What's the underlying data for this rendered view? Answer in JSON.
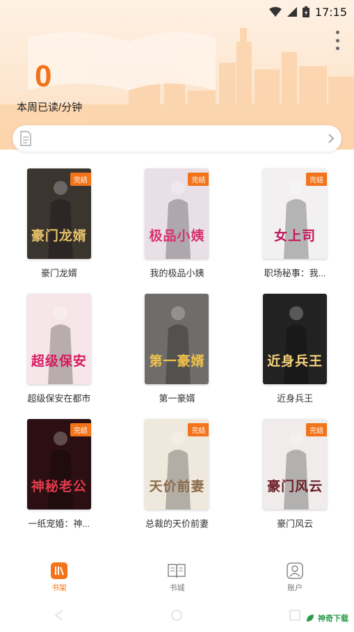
{
  "status_bar": {
    "time": "17:15"
  },
  "header": {
    "read_minutes": "0",
    "read_label": "本周已读/分钟"
  },
  "search": {
    "placeholder": ""
  },
  "badge_label": "完结",
  "books": [
    {
      "name": "豪门龙婿",
      "cover_title": "豪门龙婿",
      "badge": true,
      "bg": "#3b3530",
      "fg": "#e7c36a"
    },
    {
      "name": "我的极品小姨",
      "cover_title": "极品小姨",
      "badge": true,
      "bg": "#e9dfe6",
      "fg": "#d6336c"
    },
    {
      "name": "职场秘事：我...",
      "cover_title": "女上司",
      "badge": true,
      "bg": "#f2f0f0",
      "fg": "#c2185b"
    },
    {
      "name": "超级保安在都市",
      "cover_title": "超级保安",
      "badge": false,
      "bg": "#f6e6ea",
      "fg": "#d81b60"
    },
    {
      "name": "第一豪婿",
      "cover_title": "第一豪婿",
      "badge": false,
      "bg": "#6f6d6b",
      "fg": "#f0c24b"
    },
    {
      "name": "近身兵王",
      "cover_title": "近身兵王",
      "badge": false,
      "bg": "#222",
      "fg": "#f5d27a"
    },
    {
      "name": "一纸宠婚：神...",
      "cover_title": "神秘老公",
      "badge": true,
      "bg": "#2b0f12",
      "fg": "#e23b4c"
    },
    {
      "name": "总裁的天价前妻",
      "cover_title": "天价前妻",
      "badge": true,
      "bg": "#efe8dc",
      "fg": "#8b6b4a"
    },
    {
      "name": "豪门风云",
      "cover_title": "豪门风云",
      "badge": true,
      "bg": "#efeceb",
      "fg": "#6b1c25"
    }
  ],
  "nav": [
    {
      "label": "书架",
      "active": true
    },
    {
      "label": "书城",
      "active": false
    },
    {
      "label": "账户",
      "active": false
    }
  ],
  "watermark": "神奇下载",
  "colors": {
    "accent": "#f27319",
    "header_bg": "#fde6cf"
  }
}
